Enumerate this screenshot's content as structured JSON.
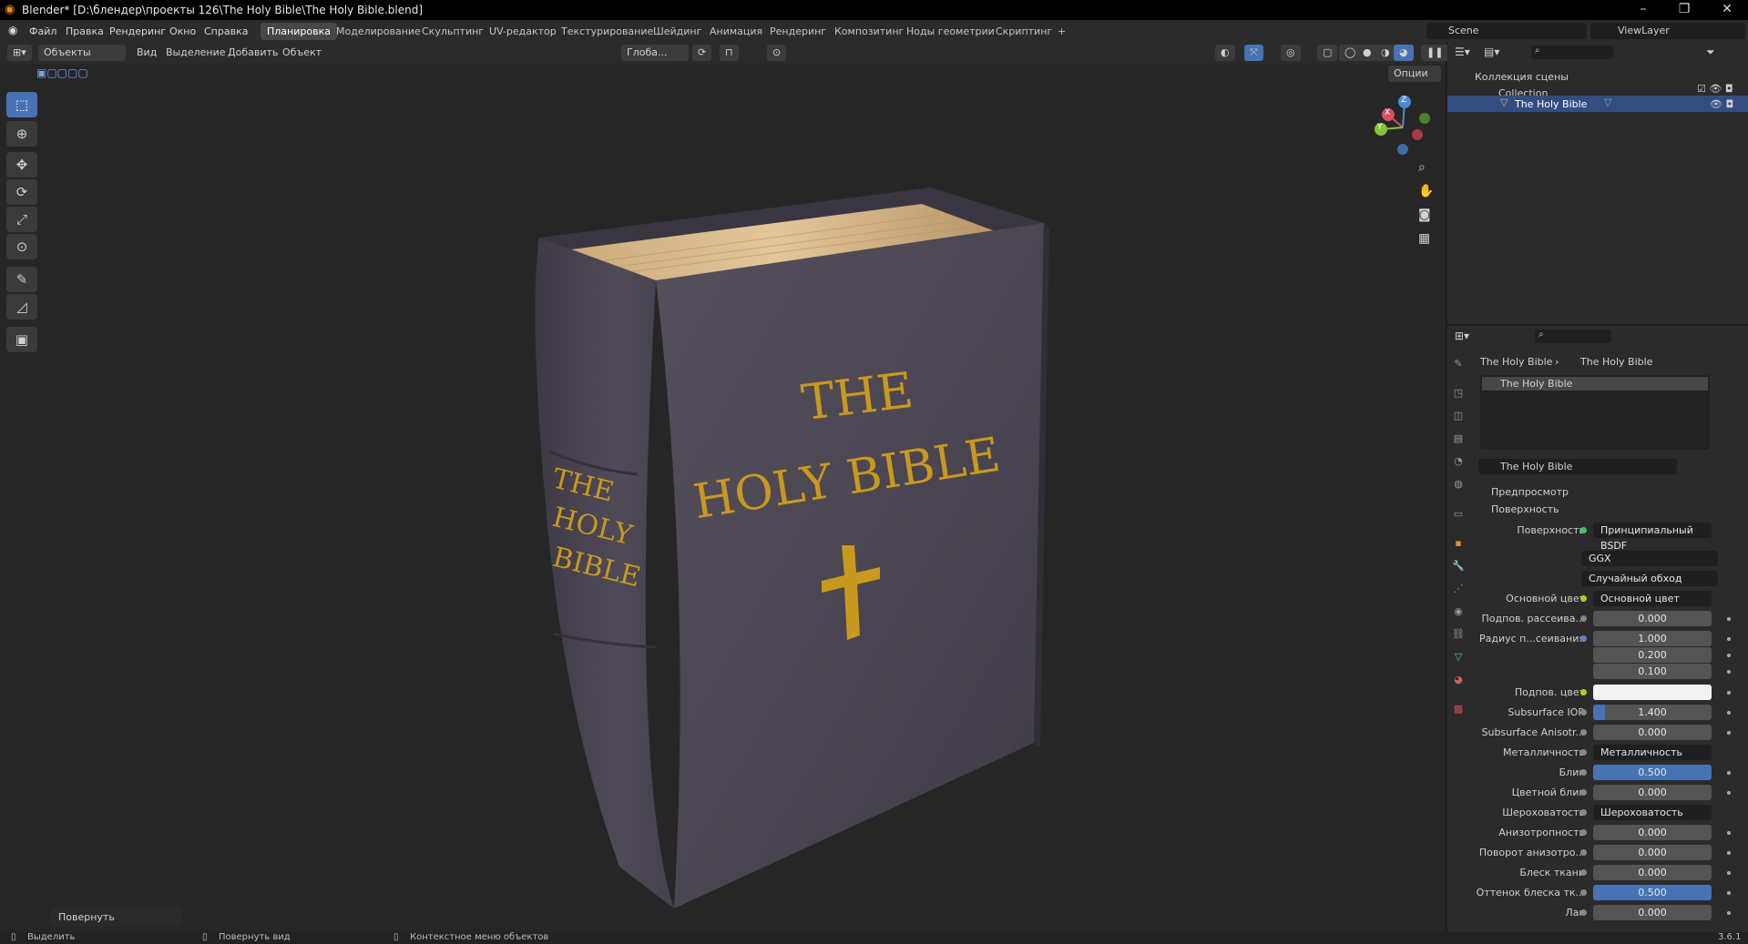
{
  "window": {
    "title": "Blender* [D:\\блендер\\проекты 126\\The Holy Bible\\The Holy Bible.blend]",
    "minimize": "–",
    "maximize": "❐",
    "close": "✕"
  },
  "menu": {
    "items": [
      "Файл",
      "Правка",
      "Рендеринг",
      "Окно",
      "Справка"
    ]
  },
  "workspaces": [
    "Планировка",
    "Моделирование",
    "Скульптинг",
    "UV-редактор",
    "Текстурирование",
    "Шейдинг",
    "Анимация",
    "Рендеринг",
    "Композитинг",
    "Ноды геометрии",
    "Скриптинг"
  ],
  "workspace_add": "+",
  "scene": {
    "label": "Scene",
    "viewlayer": "ViewLayer"
  },
  "viewport": {
    "mode": "Объекты",
    "menus": [
      "Вид",
      "Выделение",
      "Добавить",
      "Объект"
    ],
    "orientation": "Глоба...",
    "options": "Опции",
    "last_op": "Повернуть",
    "gizmo": {
      "x": "X",
      "y": "Y",
      "z": "Z"
    }
  },
  "book": {
    "front_line1": "THE",
    "front_line2": "HOLY BIBLE",
    "spine": [
      "THE",
      "HOLY",
      "BIBLE"
    ]
  },
  "outliner": {
    "root": "Коллекция сцены",
    "collection": "Collection",
    "object": "The Holy Bible"
  },
  "properties": {
    "breadcrumb_obj": "The Holy Bible",
    "breadcrumb_mat": "The Holy Bible",
    "slot": "The Holy Bible",
    "material_name": "The Holy Bible",
    "section_preview": "Предпросмотр",
    "section_surface": "Поверхность",
    "rows": [
      {
        "label": "Поверхность",
        "value": "Принципиальный BSDF",
        "kind": "dark"
      },
      {
        "label": "",
        "value": "GGX",
        "kind": "dropdown"
      },
      {
        "label": "",
        "value": "Случайный обход",
        "kind": "dropdown"
      },
      {
        "label": "Основной цвет",
        "value": "Основной цвет",
        "kind": "dark",
        "expand": true
      },
      {
        "label": "Подпов. рассеива...",
        "value": "0.000",
        "kind": "num"
      },
      {
        "label": "Радиус п...сеивания",
        "value": "1.000",
        "kind": "num"
      },
      {
        "label": "",
        "value": "0.200",
        "kind": "num"
      },
      {
        "label": "",
        "value": "0.100",
        "kind": "num"
      },
      {
        "label": "Подпов. цвет",
        "value": "",
        "kind": "white"
      },
      {
        "label": "Subsurface IOR",
        "value": "1.400",
        "kind": "num",
        "fill": 0.1
      },
      {
        "label": "Subsurface Anisotr...",
        "value": "0.000",
        "kind": "num"
      },
      {
        "label": "Металличность",
        "value": "Металличность",
        "kind": "dark",
        "expand": true
      },
      {
        "label": "Блик",
        "value": "0.500",
        "kind": "num",
        "fill": 1.0
      },
      {
        "label": "Цветной блик",
        "value": "0.000",
        "kind": "num"
      },
      {
        "label": "Шероховатость",
        "value": "Шероховатость",
        "kind": "dark",
        "expand": true
      },
      {
        "label": "Анизотропность",
        "value": "0.000",
        "kind": "num"
      },
      {
        "label": "Поворот анизотро...",
        "value": "0.000",
        "kind": "num"
      },
      {
        "label": "Блеск ткани",
        "value": "0.000",
        "kind": "num"
      },
      {
        "label": "Оттенок блеска тк...",
        "value": "0.500",
        "kind": "num",
        "fill": 1.0
      },
      {
        "label": "Лак",
        "value": "0.000",
        "kind": "num"
      }
    ]
  },
  "status": {
    "select": "Выделить",
    "rotate_view": "Повернуть вид",
    "context_menu": "Контекстное меню объектов",
    "version": "3.6.1"
  }
}
